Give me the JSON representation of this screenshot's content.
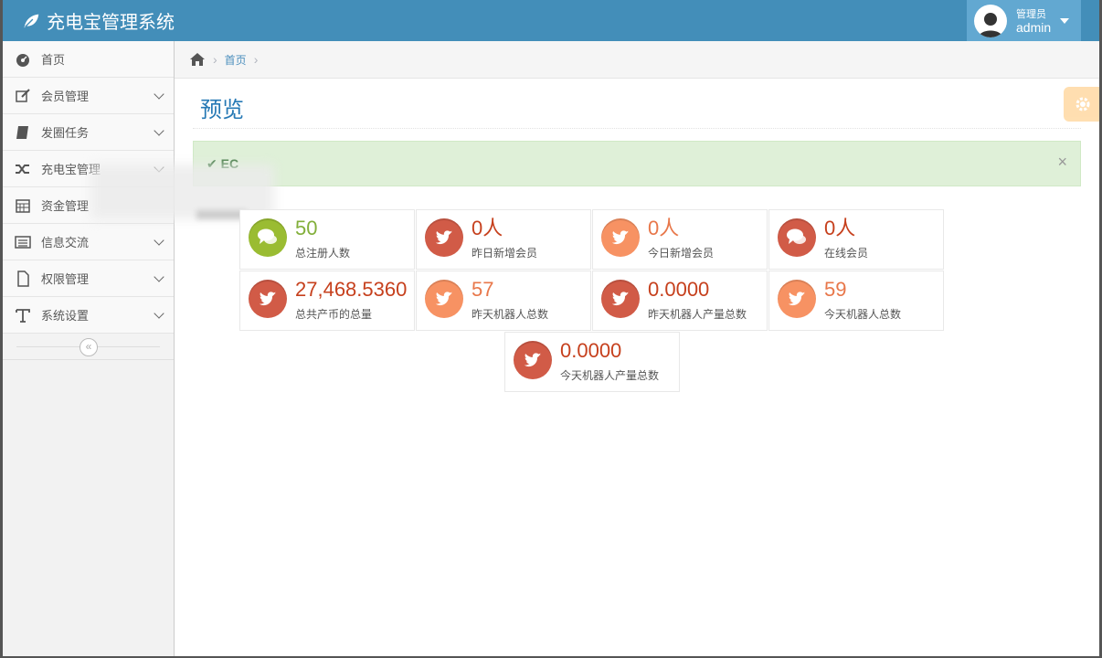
{
  "app": {
    "title": "充电宝管理系统",
    "accent": "#438eb9"
  },
  "user": {
    "welcome": "管理员",
    "name": "admin"
  },
  "sidebar": {
    "items": [
      {
        "label": "首页",
        "icon": "dashboard-icon"
      },
      {
        "label": "会员管理",
        "icon": "edit-icon"
      },
      {
        "label": "发圈任务",
        "icon": "book-icon"
      },
      {
        "label": "充电宝管理",
        "icon": "shuffle-icon"
      },
      {
        "label": "资金管理",
        "icon": "calendar-icon"
      },
      {
        "label": "信息交流",
        "icon": "list-icon"
      },
      {
        "label": "权限管理",
        "icon": "file-icon"
      },
      {
        "label": "系统设置",
        "icon": "text-icon"
      }
    ],
    "collapse_glyph": "«"
  },
  "breadcrumb": {
    "home_label": "首页",
    "sep": "›"
  },
  "page": {
    "title": "预览"
  },
  "alert": {
    "message": "✔ EC",
    "close": "×"
  },
  "stats": [
    {
      "value": "50",
      "label": "总注册人数",
      "color": "green",
      "icon": "comments-icon"
    },
    {
      "value": "0人",
      "label": "昨日新增会员",
      "color": "red",
      "icon": "twitter-icon"
    },
    {
      "value": "0人",
      "label": "今日新增会员",
      "color": "orange",
      "icon": "twitter-icon"
    },
    {
      "value": "0人",
      "label": "在线会员",
      "color": "red",
      "icon": "comments-icon"
    },
    {
      "value": "27,468.5360",
      "label": "总共产币的总量",
      "color": "red",
      "icon": "twitter-icon"
    },
    {
      "value": "57",
      "label": "昨天机器人总数",
      "color": "orange",
      "icon": "twitter-icon"
    },
    {
      "value": "0.0000",
      "label": "昨天机器人产量总数",
      "color": "red",
      "icon": "twitter-icon"
    },
    {
      "value": "59",
      "label": "今天机器人总数",
      "color": "orange",
      "icon": "twitter-icon"
    },
    {
      "value": "0.0000",
      "label": "今天机器人产量总数",
      "color": "red",
      "icon": "twitter-icon"
    }
  ]
}
